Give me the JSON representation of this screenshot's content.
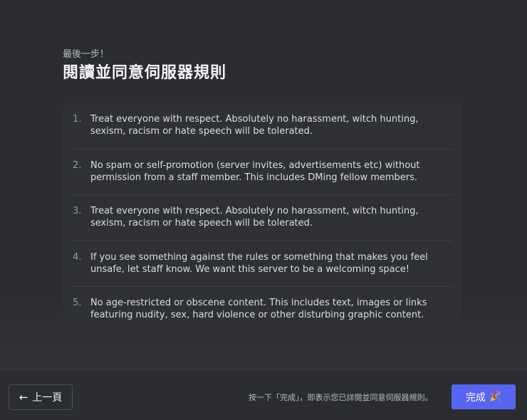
{
  "header": {
    "eyebrow": "最後一步！",
    "title": "閱讀並同意伺服器規則"
  },
  "rules": [
    {
      "num": "1.",
      "text": "Treat everyone with respect. Absolutely no harassment, witch hunting, sexism, racism or hate speech will be tolerated."
    },
    {
      "num": "2.",
      "text": "No spam or self-promotion (server invites, advertisements etc) without permission from a staff member. This includes DMing fellow members."
    },
    {
      "num": "3.",
      "text": "Treat everyone with respect. Absolutely no harassment, witch hunting, sexism, racism or hate speech will be tolerated."
    },
    {
      "num": "4.",
      "text": "If you see something against the rules or something that makes you feel unsafe, let staff know. We want this server to be a welcoming space!"
    },
    {
      "num": "5.",
      "text": "No age-restricted or obscene content. This includes text, images or links featuring nudity, sex, hard violence or other disturbing graphic content."
    }
  ],
  "footer": {
    "back_label": "上一頁",
    "back_icon": "←",
    "hint": "按一下「完成」，即表示您已詳閱並同意伺服器規則。",
    "finish_label": "完成",
    "finish_icon": "🎉"
  },
  "colors": {
    "background": "#2b2d31",
    "card": "#2f3136",
    "accent": "#5865f2"
  }
}
